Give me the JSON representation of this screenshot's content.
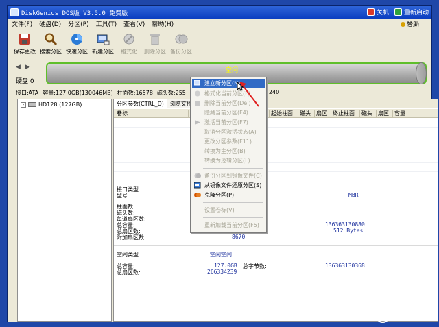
{
  "window": {
    "title": "DiskGenius DOS版 V3.5.0 免费版",
    "shutdown_label": "关机",
    "restart_label": "重新启动"
  },
  "menu": {
    "items": [
      "文件(F)",
      "硬盘(D)",
      "分区(P)",
      "工具(T)",
      "查看(V)",
      "帮助(H)"
    ],
    "donate": "赞助"
  },
  "toolbar": {
    "buttons": [
      {
        "label": "保存更改",
        "icon": "save-icon",
        "enabled": true
      },
      {
        "label": "搜索分区",
        "icon": "search-icon",
        "enabled": true
      },
      {
        "label": "快速分区",
        "icon": "quick-partition-icon",
        "enabled": true
      },
      {
        "label": "新建分区",
        "icon": "new-partition-icon",
        "enabled": true
      },
      {
        "label": "格式化",
        "icon": "format-icon",
        "enabled": false
      },
      {
        "label": "删除分区",
        "icon": "delete-icon",
        "enabled": false
      },
      {
        "label": "备份分区",
        "icon": "backup-icon",
        "enabled": false
      }
    ]
  },
  "disk": {
    "label": "硬盘 0",
    "free_label": "空闲",
    "info": {
      "interface": "接口:ATA",
      "capacity": "容量:127.0GB(130046MB)",
      "cylinders": "柱面数:16578",
      "heads": "磁头数:255",
      "sectors_tail": "240"
    }
  },
  "tree": {
    "root": "HD128:(127GB)"
  },
  "panel": {
    "tabs": [
      "分区参数(CTRL_D)",
      "浏览文件(C"
    ],
    "columns": [
      "卷标",
      "起始柱面",
      "磁头",
      "扇区",
      "终止柱面",
      "磁头",
      "扇区",
      "容量"
    ],
    "details": {
      "interface_type_label": "接口类型:",
      "model_label": "型号:",
      "partition_table_value": "MBR",
      "cylinders_label": "柱面数:",
      "heads_label": "磁头数:",
      "sectors_per_track_label": "每道扇区数:",
      "total_capacity_label": "总容量:",
      "total_sectors_label": "总扇区数:",
      "extra_sectors_label": "附加扇区数:",
      "total_bytes_value": "136363130880",
      "sector_size_value": "512 Bytes",
      "extra_sectors_value": "8670",
      "space_type_label": "空间类型:",
      "space_type_value": "空闲空间",
      "free_total_capacity_label": "总容量:",
      "free_total_capacity_value": "127.0GB",
      "free_total_bytes_label": "总字节数:",
      "free_total_bytes_value": "136363130368",
      "free_total_sectors_label": "总扇区数:",
      "free_total_sectors_value": "266334239"
    }
  },
  "context_menu": {
    "items": [
      {
        "label": "建立新分区(N)",
        "icon": "new-partition-icon",
        "enabled": true,
        "highlighted": true
      },
      {
        "label": "格式化当前分区(F)",
        "icon": "format-icon",
        "enabled": false
      },
      {
        "label": "删除当前分区(Del)",
        "icon": "delete-icon",
        "enabled": false
      },
      {
        "label": "隐藏当前分区(F4)",
        "icon": "",
        "enabled": false
      },
      {
        "label": "激活当前分区(F7)",
        "icon": "activate-icon",
        "enabled": false
      },
      {
        "label": "取消分区激活状态(A)",
        "icon": "",
        "enabled": false
      },
      {
        "label": "更改分区参数(F11)",
        "icon": "",
        "enabled": false
      },
      {
        "label": "转换为主分区(B)",
        "icon": "",
        "enabled": false
      },
      {
        "label": "转换为逻辑分区(L)",
        "icon": "",
        "enabled": false
      },
      {
        "label": "备份分区到镜像文件(C)",
        "icon": "backup-icon",
        "enabled": false
      },
      {
        "label": "从镜像文件还原分区(S)",
        "icon": "restore-icon",
        "enabled": true
      },
      {
        "label": "克隆分区(P)",
        "icon": "clone-icon",
        "enabled": true
      },
      {
        "label": "设置卷标(V)",
        "icon": "",
        "enabled": false
      },
      {
        "label": "重新加载当前分区(F5)",
        "icon": "",
        "enabled": false
      }
    ]
  },
  "watermark": {
    "text": "悟空问答"
  },
  "colors": {
    "desktop": "#1f47a8",
    "titlebar": "#0b3ec1",
    "highlight": "#316ac5",
    "free_space_border": "#5fbf2a",
    "free_label": "#ffff00"
  }
}
